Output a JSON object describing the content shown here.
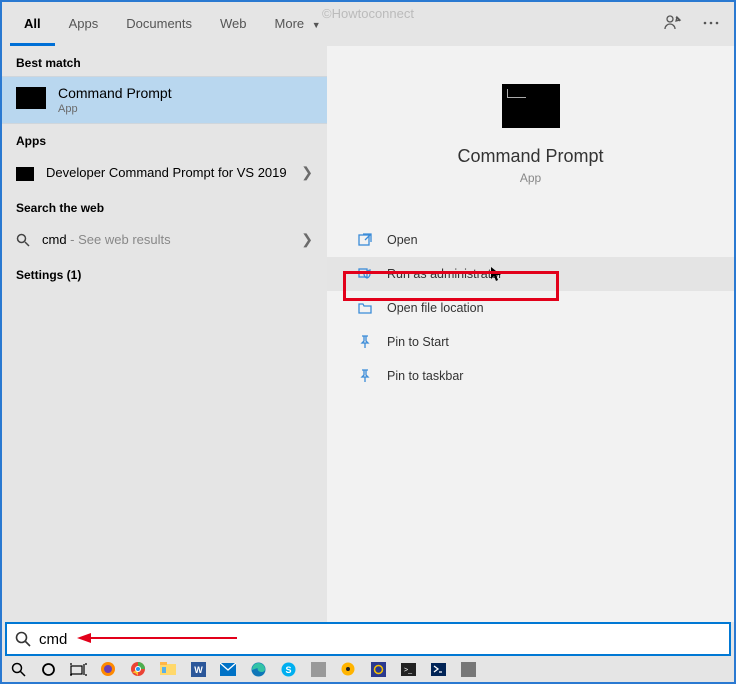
{
  "watermark": "©Howtoconnect",
  "tabs": {
    "all": "All",
    "apps": "Apps",
    "documents": "Documents",
    "web": "Web",
    "more": "More",
    "more_caret": "▼"
  },
  "sections": {
    "best_match": "Best match",
    "apps": "Apps",
    "search_web": "Search the web",
    "settings": "Settings (1)"
  },
  "best_match": {
    "title": "Command Prompt",
    "subtitle": "App"
  },
  "apps_list": [
    {
      "title": "Developer Command Prompt for VS 2019"
    }
  ],
  "search_web_item": {
    "prefix": "cmd",
    "suffix": " - See web results"
  },
  "hero": {
    "title": "Command Prompt",
    "subtitle": "App"
  },
  "actions": {
    "open": "Open",
    "run_admin": "Run as administrator",
    "open_file_location": "Open file location",
    "pin_start": "Pin to Start",
    "pin_taskbar": "Pin to taskbar"
  },
  "searchbar": {
    "value": "cmd"
  }
}
